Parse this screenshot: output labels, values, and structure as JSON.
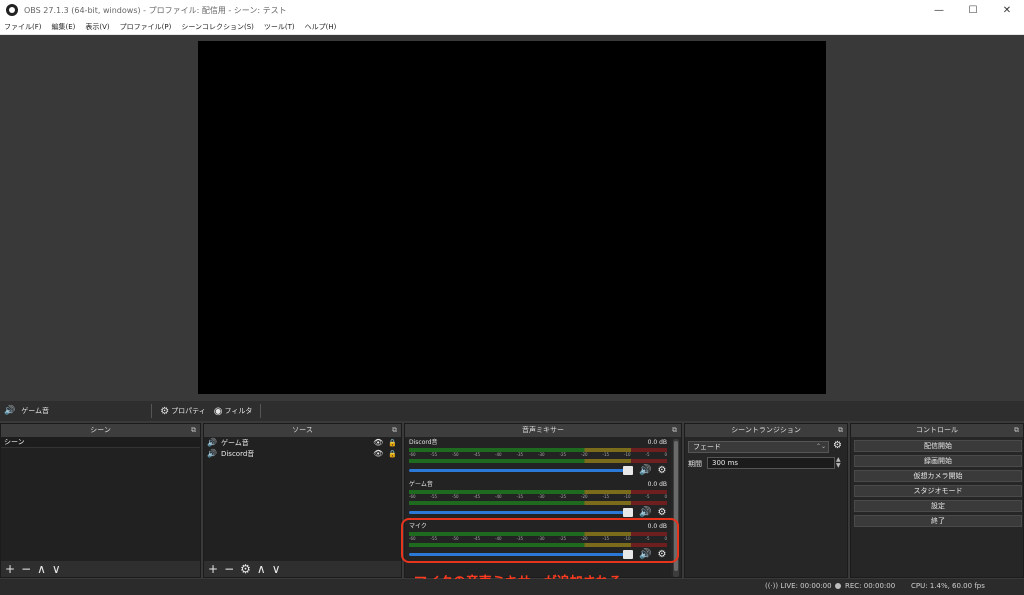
{
  "window": {
    "title": "OBS 27.1.3 (64-bit, windows) - プロファイル: 配信用 - シーン: テスト",
    "minimize": "—",
    "maximize": "☐",
    "close": "✕"
  },
  "menu": [
    "ファイル(F)",
    "編集(E)",
    "表示(V)",
    "プロファイル(P)",
    "シーンコレクション(S)",
    "ツール(T)",
    "ヘルプ(H)"
  ],
  "context_bar": {
    "source": "ゲーム音",
    "properties": "プロパティ",
    "filters": "フィルタ"
  },
  "docks": {
    "scenes": {
      "title": "シーン",
      "items": [
        "シーン"
      ]
    },
    "sources": {
      "title": "ソース",
      "items": [
        "ゲーム音",
        "Discord音"
      ]
    },
    "mixer": {
      "title": "音声ミキサー",
      "ticks": [
        "-60",
        "-55",
        "-50",
        "-45",
        "-40",
        "-35",
        "-30",
        "-25",
        "-20",
        "-15",
        "-10",
        "-5",
        "0"
      ],
      "channels": [
        {
          "name": "Discord音",
          "db": "0.0 dB"
        },
        {
          "name": "ゲーム音",
          "db": "0.0 dB"
        },
        {
          "name": "マイク",
          "db": "0.0 dB"
        }
      ]
    },
    "transitions": {
      "title": "シーントランジション",
      "type": "フェード",
      "duration_label": "期間",
      "duration": "300 ms"
    },
    "controls": {
      "title": "コントロール",
      "buttons": [
        "配信開始",
        "録画開始",
        "仮想カメラ開始",
        "スタジオモード",
        "設定",
        "終了"
      ]
    }
  },
  "annotation": "マイクの音声ミキサーが追加される",
  "status": {
    "live": "LIVE: 00:00:00",
    "rec": "REC: 00:00:00",
    "cpu": "CPU: 1.4%, 60.00 fps"
  },
  "colors": {
    "highlight": "#e8341c",
    "fader": "#2c78d6"
  }
}
